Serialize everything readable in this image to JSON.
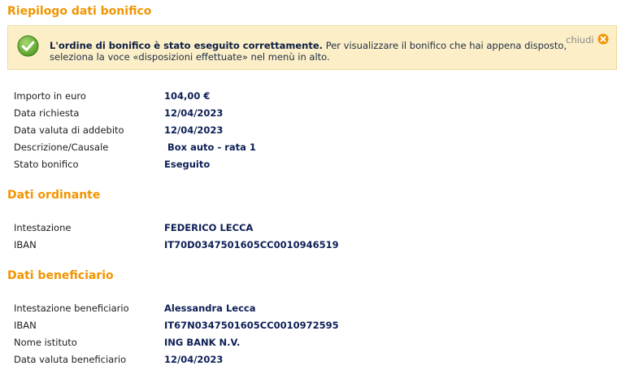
{
  "summary": {
    "title": "Riepilogo dati bonifico",
    "notice": {
      "bold_text": "L'ordine di bonifico è stato eseguito correttamente.",
      "text_line1": " Per visualizzare il bonifico che hai appena disposto,",
      "text_line2": "seleziona la voce «disposizioni effettuate» nel menù in alto.",
      "close_label": "chiudi",
      "status_icon": "check-circle-icon",
      "close_icon": "close-circle-icon"
    },
    "rows": [
      {
        "label": "Importo in euro",
        "value": "104,00 €"
      },
      {
        "label": "Data richiesta",
        "value": "12/04/2023"
      },
      {
        "label": "Data valuta di addebito",
        "value": "12/04/2023"
      },
      {
        "label": "Descrizione/Causale",
        "value": " Box auto - rata 1"
      },
      {
        "label": "Stato bonifico",
        "value": "Eseguito"
      }
    ]
  },
  "ordinante": {
    "title": "Dati ordinante",
    "rows": [
      {
        "label": "Intestazione",
        "value": "FEDERICO LECCA"
      },
      {
        "label": "IBAN",
        "value": "IT70D0347501605CC0010946519"
      }
    ]
  },
  "beneficiario": {
    "title": "Dati beneficiario",
    "rows": [
      {
        "label": "Intestazione beneficiario",
        "value": "Alessandra Lecca"
      },
      {
        "label": "IBAN",
        "value": "IT67N0347501605CC0010972595"
      },
      {
        "label": "Nome istituto",
        "value": "ING BANK N.V."
      },
      {
        "label": "Data valuta beneficiario",
        "value": "12/04/2023"
      }
    ]
  },
  "colors": {
    "accent": "#f29400",
    "notice_bg": "#fcefc7",
    "value_text": "#0d1f55",
    "success_green": "#6cb33f"
  }
}
